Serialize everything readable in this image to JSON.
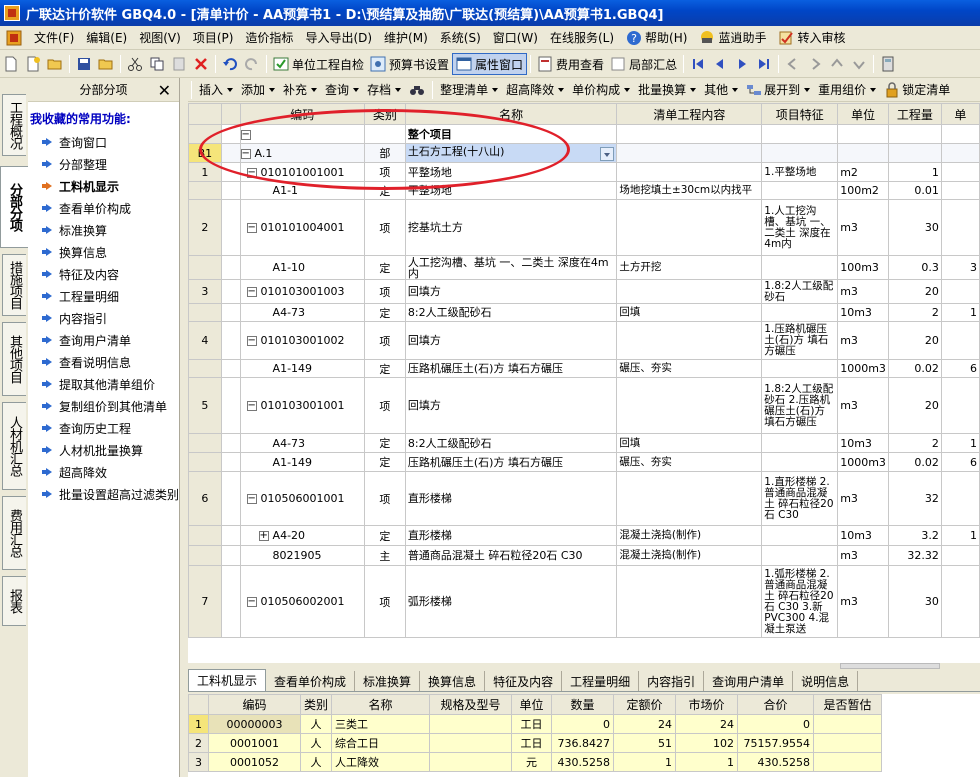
{
  "window": {
    "title": "广联达计价软件 GBQ4.0 - [清单计价 - AA预算书1 - D:\\预结算及抽筋\\广联达(预结算)\\AA预算书1.GBQ4]"
  },
  "menu": [
    {
      "label": "文件(F)"
    },
    {
      "label": "编辑(E)"
    },
    {
      "label": "视图(V)"
    },
    {
      "label": "项目(P)"
    },
    {
      "label": "造价指标"
    },
    {
      "label": "导入导出(D)"
    },
    {
      "label": "维护(M)"
    },
    {
      "label": "系统(S)"
    },
    {
      "label": "窗口(W)"
    },
    {
      "label": "在线服务(L)"
    },
    {
      "label": "帮助(H)",
      "icon": "help-icon"
    },
    {
      "label": "蓝逍助手",
      "icon": "assistant-icon"
    },
    {
      "label": "转入审核",
      "icon": "audit-icon"
    }
  ],
  "toolbar": {
    "self_check": "单位工程自检",
    "budget_settings": "预算书设置",
    "property_window": "属性窗口",
    "fee_view": "费用查看",
    "partial_summary": "局部汇总"
  },
  "toolbar2": {
    "insert": "插入",
    "add": "添加",
    "supplement": "补充",
    "query": "查询",
    "store": "存档",
    "organize": "整理清单",
    "super_reduce": "超高降效",
    "unit_price": "单价构成",
    "batch_conv": "批量换算",
    "other": "其他",
    "expand": "展开到",
    "reuse": "重用组价",
    "lock": "锁定清单"
  },
  "left_tabs": [
    "工程概况",
    "分部分项",
    "措施项目",
    "其他项目",
    "人材机汇总",
    "费用汇总",
    "报表"
  ],
  "left_panel": {
    "title": "分部分项",
    "close": "✕",
    "fav_title": "我收藏的常用功能:",
    "items": [
      {
        "label": "查询窗口"
      },
      {
        "label": "分部整理"
      },
      {
        "label": "工料机显示",
        "bold": true
      },
      {
        "label": "查看单价构成"
      },
      {
        "label": "标准换算"
      },
      {
        "label": "换算信息"
      },
      {
        "label": "特征及内容"
      },
      {
        "label": "工程量明细"
      },
      {
        "label": "内容指引"
      },
      {
        "label": "查询用户清单"
      },
      {
        "label": "查看说明信息"
      },
      {
        "label": "提取其他清单组价"
      },
      {
        "label": "复制组价到其他清单"
      },
      {
        "label": "查询历史工程"
      },
      {
        "label": "人材机批量换算"
      },
      {
        "label": "超高降效"
      },
      {
        "label": "批量设置超高过滤类别"
      }
    ]
  },
  "grid": {
    "headers": [
      "",
      "",
      "编码",
      "类别",
      "名称",
      "清单工程内容",
      "项目特征",
      "单位",
      "工程量",
      "单"
    ],
    "rows": [
      {
        "rn": "",
        "tree": "−",
        "code": "",
        "type": "",
        "name": "整个项目",
        "content": "",
        "feature": "",
        "unit": "",
        "qty": "",
        "price": "",
        "bold": true
      },
      {
        "rn": "B1",
        "tree": "−",
        "code": "A.1",
        "type": "部",
        "name": "土石方工程(十八山)",
        "content": "",
        "feature": "",
        "unit": "",
        "qty": "",
        "price": "",
        "sel": true
      },
      {
        "rn": "1",
        "tree": "−",
        "code": "010101001001",
        "type": "项",
        "name": "平整场地",
        "content": "",
        "feature": "1.平整场地",
        "unit": "m2",
        "qty": "1",
        "price": ""
      },
      {
        "rn": "",
        "tree": "",
        "code": "A1-1",
        "type": "定",
        "name": "平整场地",
        "content": "场地挖填土±30cm以内找平",
        "feature": "",
        "unit": "100m2",
        "qty": "0.01",
        "price": ""
      },
      {
        "rn": "2",
        "tree": "−",
        "code": "010101004001",
        "type": "项",
        "name": "挖基坑土方",
        "content": "",
        "feature": "1.人工挖沟槽、基坑 一、二类土 深度在4m内",
        "unit": "m3",
        "qty": "30",
        "price": ""
      },
      {
        "rn": "",
        "tree": "",
        "code": "A1-10",
        "type": "定",
        "name": "人工挖沟槽、基坑 一、二类土 深度在4m内",
        "content": "土方开挖",
        "feature": "",
        "unit": "100m3",
        "qty": "0.3",
        "price": "3"
      },
      {
        "rn": "3",
        "tree": "−",
        "code": "010103001003",
        "type": "项",
        "name": "回填方",
        "content": "",
        "feature": "1.8:2人工级配砂石",
        "unit": "m3",
        "qty": "20",
        "price": ""
      },
      {
        "rn": "",
        "tree": "",
        "code": "A4-73",
        "type": "定",
        "name": "8:2人工级配砂石",
        "content": "回填",
        "feature": "",
        "unit": "10m3",
        "qty": "2",
        "price": "1"
      },
      {
        "rn": "4",
        "tree": "−",
        "code": "010103001002",
        "type": "项",
        "name": "回填方",
        "content": "",
        "feature": "1.压路机碾压土(石)方 填石方碾压",
        "unit": "m3",
        "qty": "20",
        "price": ""
      },
      {
        "rn": "",
        "tree": "",
        "code": "A1-149",
        "type": "定",
        "name": "压路机碾压土(石)方 填石方碾压",
        "content": "碾压、夯实",
        "feature": "",
        "unit": "1000m3",
        "qty": "0.02",
        "price": "6"
      },
      {
        "rn": "5",
        "tree": "−",
        "code": "010103001001",
        "type": "项",
        "name": "回填方",
        "content": "",
        "feature": "1.8:2人工级配砂石 2.压路机碾压土(石)方 填石方碾压",
        "unit": "m3",
        "qty": "20",
        "price": ""
      },
      {
        "rn": "",
        "tree": "",
        "code": "A4-73",
        "type": "定",
        "name": "8:2人工级配砂石",
        "content": "回填",
        "feature": "",
        "unit": "10m3",
        "qty": "2",
        "price": "1"
      },
      {
        "rn": "",
        "tree": "",
        "code": "A1-149",
        "type": "定",
        "name": "压路机碾压土(石)方 填石方碾压",
        "content": "碾压、夯实",
        "feature": "",
        "unit": "1000m3",
        "qty": "0.02",
        "price": "6"
      },
      {
        "rn": "6",
        "tree": "−",
        "code": "010506001001",
        "type": "项",
        "name": "直形楼梯",
        "content": "",
        "feature": "1.直形楼梯 2.普通商品混凝土 碎石粒径20石 C30",
        "unit": "m3",
        "qty": "32",
        "price": ""
      },
      {
        "rn": "",
        "tree": "+",
        "code": "A4-20",
        "type": "定",
        "name": "直形楼梯",
        "content": "混凝土浇捣(制作)",
        "feature": "",
        "unit": "10m3",
        "qty": "3.2",
        "price": "1"
      },
      {
        "rn": "",
        "tree": "",
        "code": "8021905",
        "type": "主",
        "name": "普通商品混凝土 碎石粒径20石 C30",
        "content": "混凝土浇捣(制作)",
        "feature": "",
        "unit": "m3",
        "qty": "32.32",
        "price": ""
      },
      {
        "rn": "7",
        "tree": "−",
        "code": "010506002001",
        "type": "项",
        "name": "弧形楼梯",
        "content": "",
        "feature": "1.弧形楼梯 2.普通商品混凝土 碎石粒径20石 C30 3.新PVC300 4.混凝土泵送",
        "unit": "m3",
        "qty": "30",
        "price": ""
      }
    ]
  },
  "bottom_tabs": [
    "工料机显示",
    "查看单价构成",
    "标准换算",
    "换算信息",
    "特征及内容",
    "工程量明细",
    "内容指引",
    "查询用户清单",
    "说明信息"
  ],
  "sub_grid": {
    "headers": [
      "",
      "编码",
      "类别",
      "名称",
      "规格及型号",
      "单位",
      "数量",
      "定额价",
      "市场价",
      "合价",
      "是否暂估"
    ],
    "rows": [
      {
        "rn": "1",
        "code": "00000003",
        "type": "人",
        "name": "三类工",
        "spec": "",
        "unit": "工日",
        "qty": "0",
        "quota": "24",
        "market": "24",
        "total": "0",
        "est": ""
      },
      {
        "rn": "2",
        "code": "0001001",
        "type": "人",
        "name": "综合工日",
        "spec": "",
        "unit": "工日",
        "qty": "736.8427",
        "quota": "51",
        "market": "102",
        "total": "75157.9554",
        "est": ""
      },
      {
        "rn": "3",
        "code": "0001052",
        "type": "人",
        "name": "人工降效",
        "spec": "",
        "unit": "元",
        "qty": "430.5258",
        "quota": "1",
        "market": "1",
        "total": "430.5258",
        "est": ""
      }
    ]
  }
}
